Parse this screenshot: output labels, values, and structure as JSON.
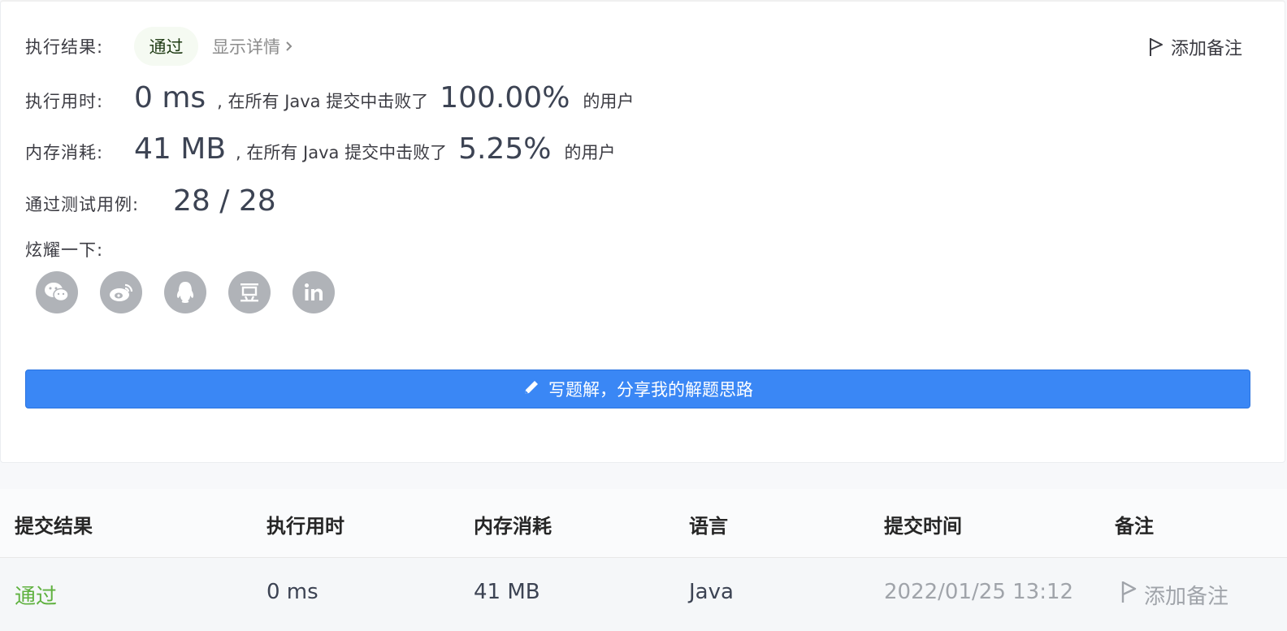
{
  "result": {
    "label": "执行结果:",
    "status": "通过",
    "details_link": "显示详情",
    "add_note": "添加备注"
  },
  "runtime": {
    "label": "执行用时:",
    "value": "0 ms",
    "beat_text": ", 在所有 Java 提交中击败了",
    "percent": "100.00%",
    "suffix": "的用户"
  },
  "memory": {
    "label": "内存消耗:",
    "value": "41 MB",
    "beat_text": ", 在所有 Java 提交中击败了",
    "percent": "5.25%",
    "suffix": "的用户"
  },
  "testcases": {
    "label": "通过测试用例:",
    "value": "28 / 28"
  },
  "share": {
    "label": "炫耀一下:",
    "icons": [
      "wechat-icon",
      "weibo-icon",
      "qq-icon",
      "douban-icon",
      "linkedin-icon"
    ]
  },
  "write_solution": {
    "label": "写题解，分享我的解题思路"
  },
  "table": {
    "headers": [
      "提交结果",
      "执行用时",
      "内存消耗",
      "语言",
      "提交时间",
      "备注"
    ],
    "row": {
      "status": "通过",
      "runtime": "0 ms",
      "memory": "41 MB",
      "language": "Java",
      "time": "2022/01/25 13:12",
      "note": "添加备注"
    }
  },
  "colors": {
    "accent": "#3a87f5",
    "pass": "#5fb13f",
    "icon_bg": "#b0b3b8"
  }
}
